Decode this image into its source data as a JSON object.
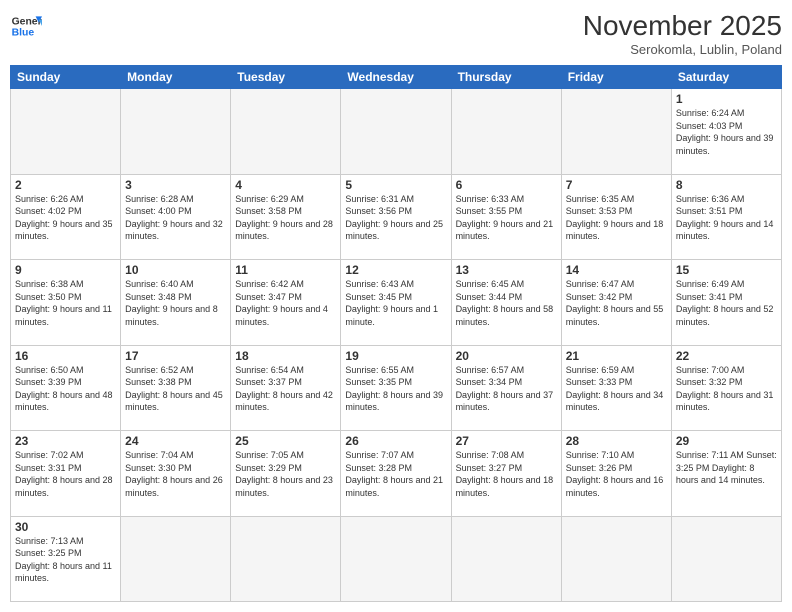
{
  "logo": {
    "line1": "General",
    "line2": "Blue"
  },
  "title": "November 2025",
  "location": "Serokomla, Lublin, Poland",
  "days_of_week": [
    "Sunday",
    "Monday",
    "Tuesday",
    "Wednesday",
    "Thursday",
    "Friday",
    "Saturday"
  ],
  "weeks": [
    [
      {
        "day": "",
        "info": ""
      },
      {
        "day": "",
        "info": ""
      },
      {
        "day": "",
        "info": ""
      },
      {
        "day": "",
        "info": ""
      },
      {
        "day": "",
        "info": ""
      },
      {
        "day": "",
        "info": ""
      },
      {
        "day": "1",
        "info": "Sunrise: 6:24 AM\nSunset: 4:03 PM\nDaylight: 9 hours\nand 39 minutes."
      }
    ],
    [
      {
        "day": "2",
        "info": "Sunrise: 6:26 AM\nSunset: 4:02 PM\nDaylight: 9 hours\nand 35 minutes."
      },
      {
        "day": "3",
        "info": "Sunrise: 6:28 AM\nSunset: 4:00 PM\nDaylight: 9 hours\nand 32 minutes."
      },
      {
        "day": "4",
        "info": "Sunrise: 6:29 AM\nSunset: 3:58 PM\nDaylight: 9 hours\nand 28 minutes."
      },
      {
        "day": "5",
        "info": "Sunrise: 6:31 AM\nSunset: 3:56 PM\nDaylight: 9 hours\nand 25 minutes."
      },
      {
        "day": "6",
        "info": "Sunrise: 6:33 AM\nSunset: 3:55 PM\nDaylight: 9 hours\nand 21 minutes."
      },
      {
        "day": "7",
        "info": "Sunrise: 6:35 AM\nSunset: 3:53 PM\nDaylight: 9 hours\nand 18 minutes."
      },
      {
        "day": "8",
        "info": "Sunrise: 6:36 AM\nSunset: 3:51 PM\nDaylight: 9 hours\nand 14 minutes."
      }
    ],
    [
      {
        "day": "9",
        "info": "Sunrise: 6:38 AM\nSunset: 3:50 PM\nDaylight: 9 hours\nand 11 minutes."
      },
      {
        "day": "10",
        "info": "Sunrise: 6:40 AM\nSunset: 3:48 PM\nDaylight: 9 hours\nand 8 minutes."
      },
      {
        "day": "11",
        "info": "Sunrise: 6:42 AM\nSunset: 3:47 PM\nDaylight: 9 hours\nand 4 minutes."
      },
      {
        "day": "12",
        "info": "Sunrise: 6:43 AM\nSunset: 3:45 PM\nDaylight: 9 hours\nand 1 minute."
      },
      {
        "day": "13",
        "info": "Sunrise: 6:45 AM\nSunset: 3:44 PM\nDaylight: 8 hours\nand 58 minutes."
      },
      {
        "day": "14",
        "info": "Sunrise: 6:47 AM\nSunset: 3:42 PM\nDaylight: 8 hours\nand 55 minutes."
      },
      {
        "day": "15",
        "info": "Sunrise: 6:49 AM\nSunset: 3:41 PM\nDaylight: 8 hours\nand 52 minutes."
      }
    ],
    [
      {
        "day": "16",
        "info": "Sunrise: 6:50 AM\nSunset: 3:39 PM\nDaylight: 8 hours\nand 48 minutes."
      },
      {
        "day": "17",
        "info": "Sunrise: 6:52 AM\nSunset: 3:38 PM\nDaylight: 8 hours\nand 45 minutes."
      },
      {
        "day": "18",
        "info": "Sunrise: 6:54 AM\nSunset: 3:37 PM\nDaylight: 8 hours\nand 42 minutes."
      },
      {
        "day": "19",
        "info": "Sunrise: 6:55 AM\nSunset: 3:35 PM\nDaylight: 8 hours\nand 39 minutes."
      },
      {
        "day": "20",
        "info": "Sunrise: 6:57 AM\nSunset: 3:34 PM\nDaylight: 8 hours\nand 37 minutes."
      },
      {
        "day": "21",
        "info": "Sunrise: 6:59 AM\nSunset: 3:33 PM\nDaylight: 8 hours\nand 34 minutes."
      },
      {
        "day": "22",
        "info": "Sunrise: 7:00 AM\nSunset: 3:32 PM\nDaylight: 8 hours\nand 31 minutes."
      }
    ],
    [
      {
        "day": "23",
        "info": "Sunrise: 7:02 AM\nSunset: 3:31 PM\nDaylight: 8 hours\nand 28 minutes."
      },
      {
        "day": "24",
        "info": "Sunrise: 7:04 AM\nSunset: 3:30 PM\nDaylight: 8 hours\nand 26 minutes."
      },
      {
        "day": "25",
        "info": "Sunrise: 7:05 AM\nSunset: 3:29 PM\nDaylight: 8 hours\nand 23 minutes."
      },
      {
        "day": "26",
        "info": "Sunrise: 7:07 AM\nSunset: 3:28 PM\nDaylight: 8 hours\nand 21 minutes."
      },
      {
        "day": "27",
        "info": "Sunrise: 7:08 AM\nSunset: 3:27 PM\nDaylight: 8 hours\nand 18 minutes."
      },
      {
        "day": "28",
        "info": "Sunrise: 7:10 AM\nSunset: 3:26 PM\nDaylight: 8 hours\nand 16 minutes."
      },
      {
        "day": "29",
        "info": "Sunrise: 7:11 AM\nSunset: 3:25 PM\nDaylight: 8 hours\nand 14 minutes."
      }
    ],
    [
      {
        "day": "30",
        "info": "Sunrise: 7:13 AM\nSunset: 3:25 PM\nDaylight: 8 hours\nand 11 minutes."
      },
      {
        "day": "",
        "info": ""
      },
      {
        "day": "",
        "info": ""
      },
      {
        "day": "",
        "info": ""
      },
      {
        "day": "",
        "info": ""
      },
      {
        "day": "",
        "info": ""
      },
      {
        "day": "",
        "info": ""
      }
    ]
  ]
}
